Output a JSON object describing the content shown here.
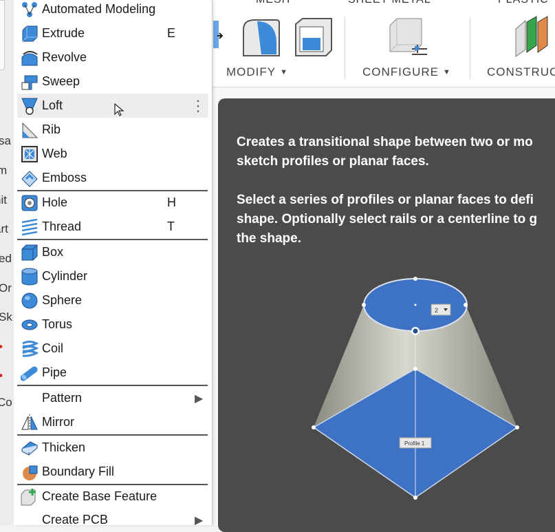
{
  "toolbar": {
    "tabs": [
      "MESH",
      "SHEET METAL",
      "PLASTIC"
    ],
    "groups": {
      "modify": "MODIFY",
      "configure": "CONFIGURE",
      "construct": "CONSTRUC"
    }
  },
  "left_panel": {
    "stubs": [
      "sa",
      "m",
      "nit",
      "art",
      "ed",
      "Or",
      "Sk",
      "Co"
    ]
  },
  "menu": {
    "items": [
      {
        "label": "Automated Modeling",
        "icon": "automated-modeling-icon",
        "shortcut": ""
      },
      {
        "label": "Extrude",
        "icon": "extrude-icon",
        "shortcut": "E"
      },
      {
        "label": "Revolve",
        "icon": "revolve-icon",
        "shortcut": ""
      },
      {
        "label": "Sweep",
        "icon": "sweep-icon",
        "shortcut": ""
      },
      {
        "label": "Loft",
        "icon": "loft-icon",
        "shortcut": "",
        "more": "⋮"
      },
      {
        "label": "Rib",
        "icon": "rib-icon",
        "shortcut": ""
      },
      {
        "label": "Web",
        "icon": "web-icon",
        "shortcut": ""
      },
      {
        "label": "Emboss",
        "icon": "emboss-icon",
        "shortcut": ""
      },
      {
        "label": "Hole",
        "icon": "hole-icon",
        "shortcut": "H"
      },
      {
        "label": "Thread",
        "icon": "thread-icon",
        "shortcut": "T"
      },
      {
        "label": "Box",
        "icon": "box-icon",
        "shortcut": ""
      },
      {
        "label": "Cylinder",
        "icon": "cylinder-icon",
        "shortcut": ""
      },
      {
        "label": "Sphere",
        "icon": "sphere-icon",
        "shortcut": ""
      },
      {
        "label": "Torus",
        "icon": "torus-icon",
        "shortcut": ""
      },
      {
        "label": "Coil",
        "icon": "coil-icon",
        "shortcut": ""
      },
      {
        "label": "Pipe",
        "icon": "pipe-icon",
        "shortcut": ""
      },
      {
        "label": "Pattern",
        "icon": "",
        "shortcut": "",
        "submenu": "▶"
      },
      {
        "label": "Mirror",
        "icon": "mirror-icon",
        "shortcut": ""
      },
      {
        "label": "Thicken",
        "icon": "thicken-icon",
        "shortcut": ""
      },
      {
        "label": "Boundary Fill",
        "icon": "boundary-fill-icon",
        "shortcut": ""
      },
      {
        "label": "Create Base Feature",
        "icon": "create-base-feature-icon",
        "shortcut": ""
      },
      {
        "label": "Create PCB",
        "icon": "",
        "shortcut": "",
        "submenu": "▶"
      }
    ]
  },
  "tooltip": {
    "line1": "Creates a transitional shape between two or mo",
    "line2": "sketch profiles or planar faces.",
    "line3": "Select a series of profiles or planar faces to defi",
    "line4": "shape. Optionally select rails or a centerline to g",
    "line5": "the shape.",
    "illustration": {
      "dropdown_value": "2",
      "profile_label": "Profile 1"
    }
  },
  "colors": {
    "accent_blue": "#3a78c9",
    "tooltip_bg": "#4b4b4b",
    "hover_bg": "#ededed"
  }
}
